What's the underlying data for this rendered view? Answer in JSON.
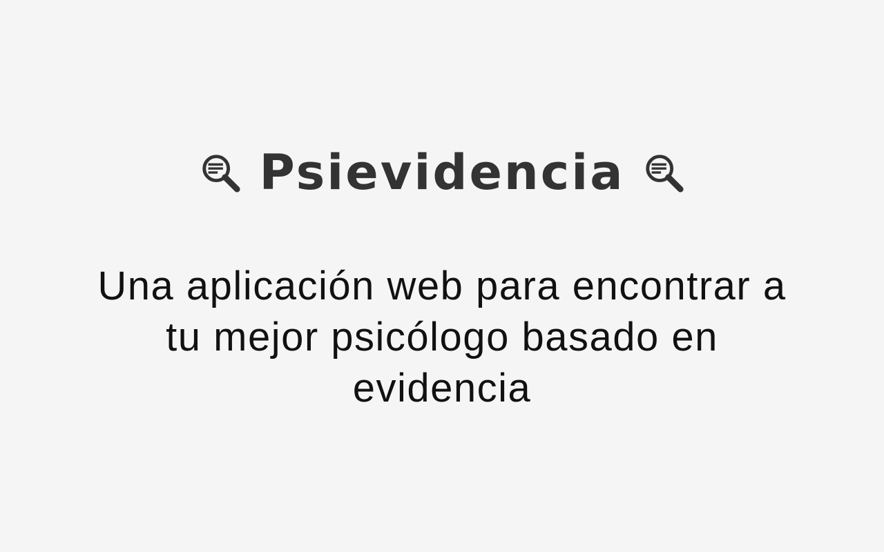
{
  "header": {
    "title": "Psievidencia",
    "left_icon": "manage-search-icon",
    "right_icon": "manage-search-icon"
  },
  "main": {
    "tagline": "Una aplicación web para encontrar a tu mejor psicólogo basado en evidencia"
  },
  "colors": {
    "background": "#f4f5f4",
    "title": "#333333",
    "tagline": "#111111"
  }
}
